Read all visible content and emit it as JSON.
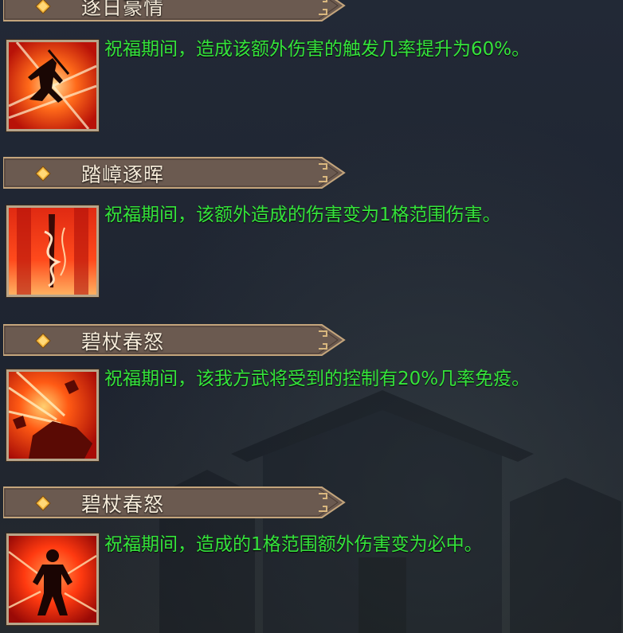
{
  "colors": {
    "description_text": "#35e43b",
    "title_text": "#f4ead8",
    "banner_fill": "#6e5b52",
    "banner_border": "#c4a57c",
    "diamond": "#f0b43a",
    "background": "#1f2531"
  },
  "entries": [
    {
      "title": "逐日豪情",
      "icon": "swordsman-silhouette-icon",
      "description": "祝福期间，造成该额外伤害的触发几率提升为60%。"
    },
    {
      "title": "踏嶂逐晖",
      "icon": "spear-flame-icon",
      "description": "祝福期间，该额外造成的伤害变为1格范围伤害。"
    },
    {
      "title": "碧杖春怒",
      "icon": "shattered-rock-icon",
      "description": "祝福期间，该我方武将受到的控制有20%几率免疫。"
    },
    {
      "title": "碧杖春怒",
      "icon": "warrior-aura-icon",
      "description": "祝福期间，造成的1格范围额外伤害变为必中。"
    }
  ]
}
